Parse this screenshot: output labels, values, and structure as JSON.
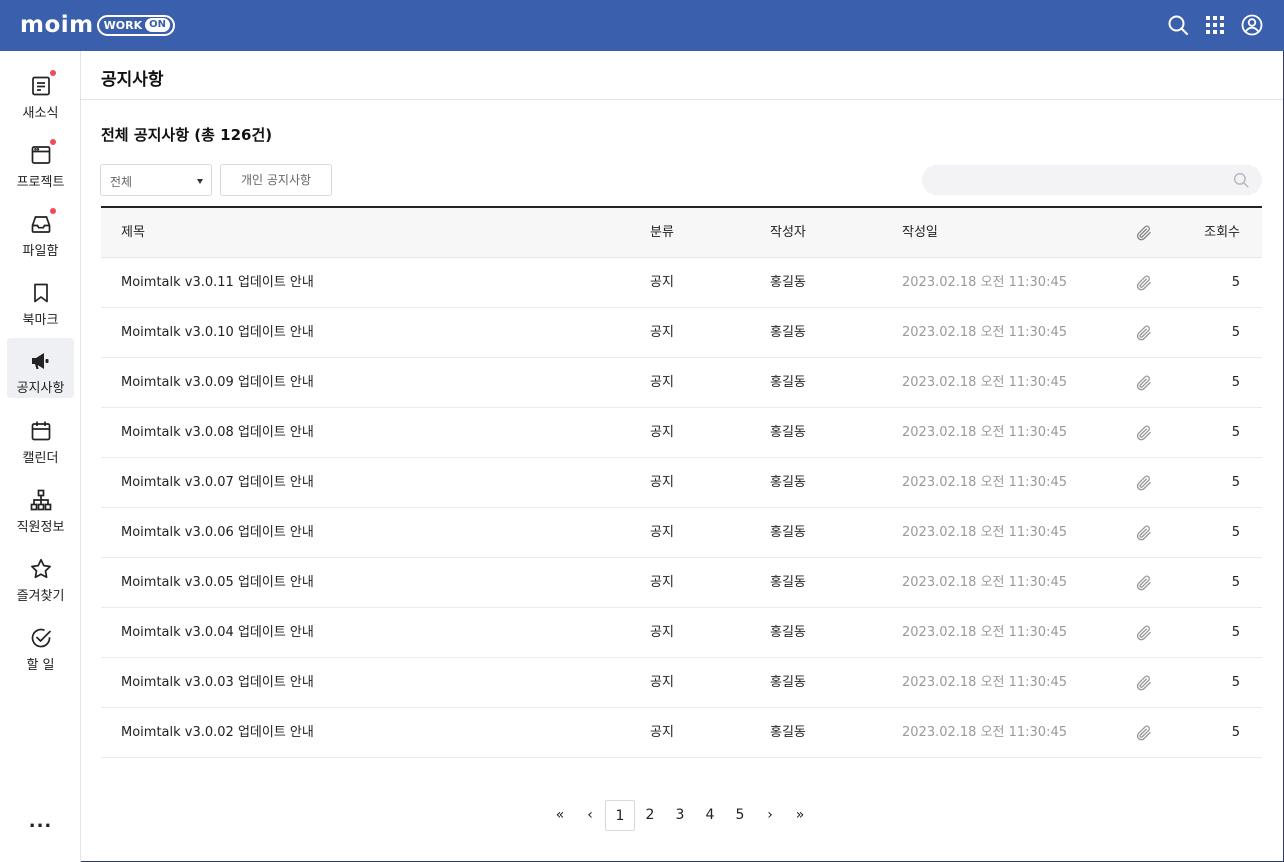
{
  "header": {
    "logo": "moim",
    "badge_work": "WORK",
    "badge_on": "ON"
  },
  "sidebar": {
    "items": [
      {
        "label": "새소식",
        "icon": "news-icon",
        "has_dot": true
      },
      {
        "label": "프로젝트",
        "icon": "project-icon",
        "has_dot": true
      },
      {
        "label": "파일함",
        "icon": "inbox-icon",
        "has_dot": true
      },
      {
        "label": "북마크",
        "icon": "bookmark-icon",
        "has_dot": false
      },
      {
        "label": "공지사항",
        "icon": "megaphone-icon",
        "has_dot": false,
        "active": true
      },
      {
        "label": "캘린더",
        "icon": "calendar-icon",
        "has_dot": false
      },
      {
        "label": "직원정보",
        "icon": "org-chart-icon",
        "has_dot": false
      },
      {
        "label": "즐겨찾기",
        "icon": "star-icon",
        "has_dot": false
      },
      {
        "label": "할 일",
        "icon": "check-circle-icon",
        "has_dot": false
      }
    ],
    "more": "..."
  },
  "page": {
    "title": "공지사항",
    "section_title": "전체 공지사항 (총",
    "count": "126건)"
  },
  "filters": {
    "category_selected": "전체",
    "personal_button": "개인 공지사항",
    "search_placeholder": ""
  },
  "table": {
    "headers": {
      "title": "제목",
      "category": "분류",
      "author": "작성자",
      "date": "작성일",
      "views": "조회수"
    },
    "rows": [
      {
        "title": "Moimtalk v3.0.11 업데이트 안내",
        "category": "공지",
        "author": "홍길동",
        "date": "2023.02.18  오전 11:30:45",
        "views": "5"
      },
      {
        "title": "Moimtalk v3.0.10 업데이트 안내",
        "category": "공지",
        "author": "홍길동",
        "date": "2023.02.18  오전 11:30:45",
        "views": "5"
      },
      {
        "title": "Moimtalk v3.0.09 업데이트 안내",
        "category": "공지",
        "author": "홍길동",
        "date": "2023.02.18  오전 11:30:45",
        "views": "5"
      },
      {
        "title": "Moimtalk v3.0.08 업데이트 안내",
        "category": "공지",
        "author": "홍길동",
        "date": "2023.02.18  오전 11:30:45",
        "views": "5"
      },
      {
        "title": "Moimtalk v3.0.07 업데이트 안내",
        "category": "공지",
        "author": "홍길동",
        "date": "2023.02.18  오전 11:30:45",
        "views": "5"
      },
      {
        "title": "Moimtalk v3.0.06 업데이트 안내",
        "category": "공지",
        "author": "홍길동",
        "date": "2023.02.18  오전 11:30:45",
        "views": "5"
      },
      {
        "title": "Moimtalk v3.0.05 업데이트 안내",
        "category": "공지",
        "author": "홍길동",
        "date": "2023.02.18  오전 11:30:45",
        "views": "5"
      },
      {
        "title": "Moimtalk v3.0.04 업데이트 안내",
        "category": "공지",
        "author": "홍길동",
        "date": "2023.02.18  오전 11:30:45",
        "views": "5"
      },
      {
        "title": "Moimtalk v3.0.03 업데이트 안내",
        "category": "공지",
        "author": "홍길동",
        "date": "2023.02.18  오전 11:30:45",
        "views": "5"
      },
      {
        "title": "Moimtalk v3.0.02 업데이트 안내",
        "category": "공지",
        "author": "홍길동",
        "date": "2023.02.18  오전 11:30:45",
        "views": "5"
      }
    ]
  },
  "pagination": {
    "first": "«",
    "prev": "‹",
    "pages": [
      "1",
      "2",
      "3",
      "4",
      "5"
    ],
    "current": "1",
    "next": "›",
    "last": "»"
  },
  "colors": {
    "brand": "#3a5fad",
    "notification_dot": "#ef4b5a"
  }
}
